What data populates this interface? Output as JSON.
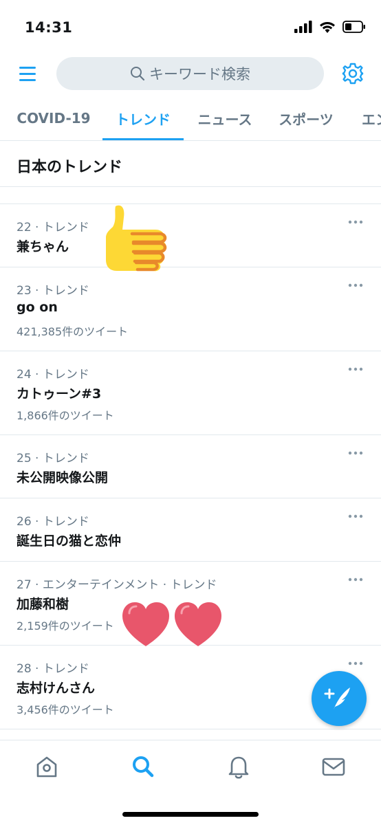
{
  "status_bar": {
    "time": "14:31"
  },
  "search": {
    "placeholder": "キーワード検索"
  },
  "tabs": [
    {
      "label": "COVID-19"
    },
    {
      "label": "トレンド"
    },
    {
      "label": "ニュース"
    },
    {
      "label": "スポーツ"
    },
    {
      "label": "エン"
    }
  ],
  "section": {
    "title": "日本のトレンド"
  },
  "trends": [
    {
      "meta": "22 · トレンド",
      "name": "兼ちゃん",
      "count": ""
    },
    {
      "meta": "23 · トレンド",
      "name": "go on",
      "count": "421,385件のツイート"
    },
    {
      "meta": "24 · トレンド",
      "name": "カトゥーン#3",
      "count": "1,866件のツイート"
    },
    {
      "meta": "25 · トレンド",
      "name": "未公開映像公開",
      "count": ""
    },
    {
      "meta": "26 · トレンド",
      "name": "誕生日の猫と恋仲",
      "count": ""
    },
    {
      "meta": "27 · エンターテインメント · トレンド",
      "name": "加藤和樹",
      "count": "2,159件のツイート"
    },
    {
      "meta": "28 · トレンド",
      "name": "志村けんさん",
      "count": "3,456件のツイート"
    }
  ],
  "colors": {
    "accent": "#1da1f2",
    "secondary_text": "#657786",
    "divider": "#e1e8ed"
  },
  "icons": {
    "menu": "menu-icon",
    "search": "search-icon",
    "settings": "gear-icon",
    "more": "more-icon",
    "compose": "compose-tweet-icon",
    "home": "home-icon",
    "explore": "search-icon",
    "notifications": "bell-icon",
    "messages": "mail-icon"
  }
}
